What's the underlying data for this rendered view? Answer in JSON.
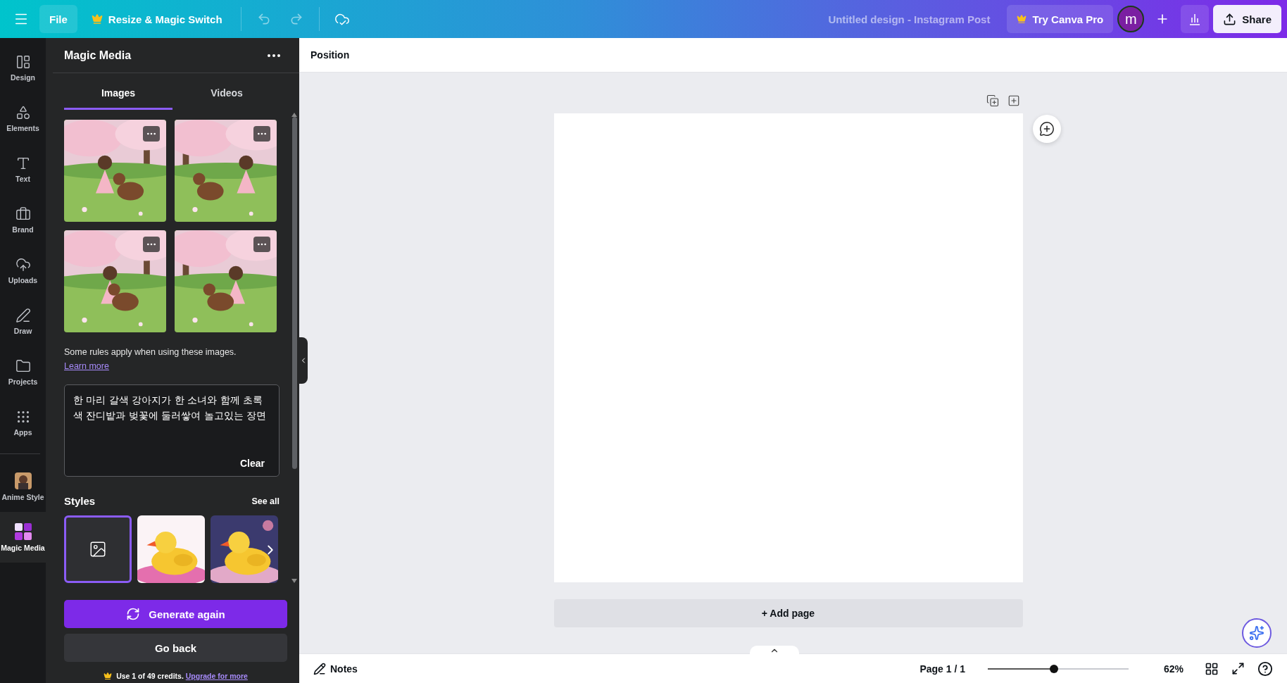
{
  "topbar": {
    "file": "File",
    "resize": "Resize & Magic Switch",
    "title": "Untitled design - Instagram Post",
    "try_pro": "Try Canva Pro",
    "avatar": "m",
    "share": "Share"
  },
  "rail": [
    {
      "label": "Design",
      "kind": "design",
      "selected": false
    },
    {
      "label": "Elements",
      "kind": "elements",
      "selected": false
    },
    {
      "label": "Text",
      "kind": "text",
      "selected": false
    },
    {
      "label": "Brand",
      "kind": "brand",
      "selected": false
    },
    {
      "label": "Uploads",
      "kind": "uploads",
      "selected": false
    },
    {
      "label": "Draw",
      "kind": "draw",
      "selected": false
    },
    {
      "label": "Projects",
      "kind": "projects",
      "selected": false
    },
    {
      "label": "Apps",
      "kind": "apps",
      "selected": false
    },
    {
      "label": "Anime Style",
      "kind": "app-picture",
      "selected": false
    },
    {
      "label": "Magic Media",
      "kind": "magic",
      "selected": true
    }
  ],
  "panel": {
    "title": "Magic Media",
    "tabs": [
      {
        "label": "Images",
        "selected": true
      },
      {
        "label": "Videos",
        "selected": false
      }
    ],
    "results": [
      {
        "kind": "picture"
      },
      {
        "kind": "picture"
      },
      {
        "kind": "picture"
      },
      {
        "kind": "picture"
      }
    ],
    "notice": "Some rules apply when using these images.",
    "notice_link": "Learn more",
    "prompt": "한 마리 갈색 강아지가 한 소녀와 함께 초록색 잔디밭과 벚꽃에 둘러쌓여 놀고있는 장면",
    "clear": "Clear",
    "styles_title": "Styles",
    "see_all": "See all",
    "styles": [
      {
        "kind": "none",
        "selected": true
      },
      {
        "kind": "picture",
        "selected": false
      },
      {
        "kind": "picture",
        "selected": false
      }
    ],
    "generate": "Generate again",
    "go_back": "Go back",
    "credits": "Use 1 of 49 credits.",
    "credits_link": "Upgrade for more"
  },
  "toolbar": {
    "position": "Position"
  },
  "canvas": {
    "add_page": "+ Add page"
  },
  "footer": {
    "notes": "Notes",
    "page": "Page 1 / 1",
    "zoom": {
      "level": 0.47,
      "reading": "62%"
    }
  }
}
